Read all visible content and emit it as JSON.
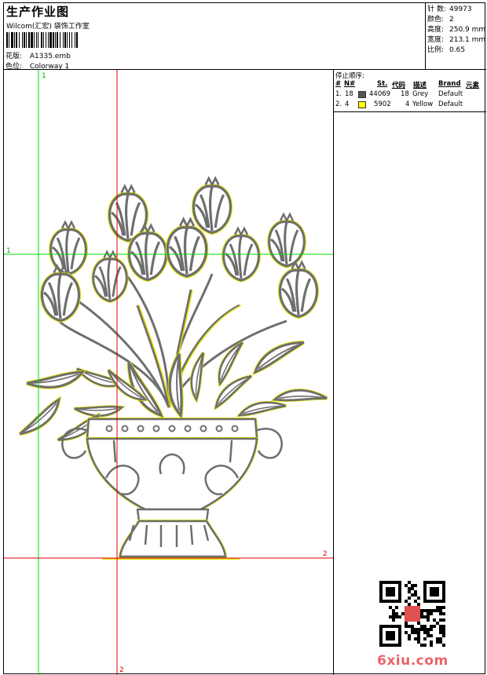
{
  "header": {
    "title": "生产作业图",
    "company": "Wilcom(汇宏) 袋饰工作室",
    "pattern_label": "花版:",
    "pattern_value": "A1335.emb",
    "color_label": "色位:",
    "color_value": "Colorway 1"
  },
  "stats": {
    "stitches_label": "针 数:",
    "stitches_value": "49973",
    "colors_label": "颜色:",
    "colors_value": "2",
    "height_label": "高度:",
    "height_value": "250.9 mm",
    "width_label": "宽度:",
    "width_value": "213.1 mm",
    "scale_label": "比例:",
    "scale_value": "0.65"
  },
  "stop_sequence": {
    "title": "停止顺序:",
    "headers": [
      "#",
      "N#",
      "St.",
      "代码",
      "描述",
      "Brand",
      "元素"
    ],
    "rows": [
      {
        "index": "1.",
        "needle": "18",
        "color": "#555555",
        "stitches": "44069",
        "code": "18",
        "desc": "Grey",
        "brand": "Default"
      },
      {
        "index": "2.",
        "needle": "4",
        "color": "#ffff00",
        "stitches": "5902",
        "code": "4",
        "desc": "Yellow",
        "brand": "Default"
      }
    ]
  },
  "guides": {
    "v1_label": "1",
    "h1_label": "1",
    "v2_label": "2",
    "h2_label": "2",
    "green": "#00dd00",
    "red": "#dd0000"
  },
  "watermark": "6xiu.com",
  "colors": {
    "thread_grey": "#6e6e6e",
    "thread_yellow": "#e8e800"
  }
}
